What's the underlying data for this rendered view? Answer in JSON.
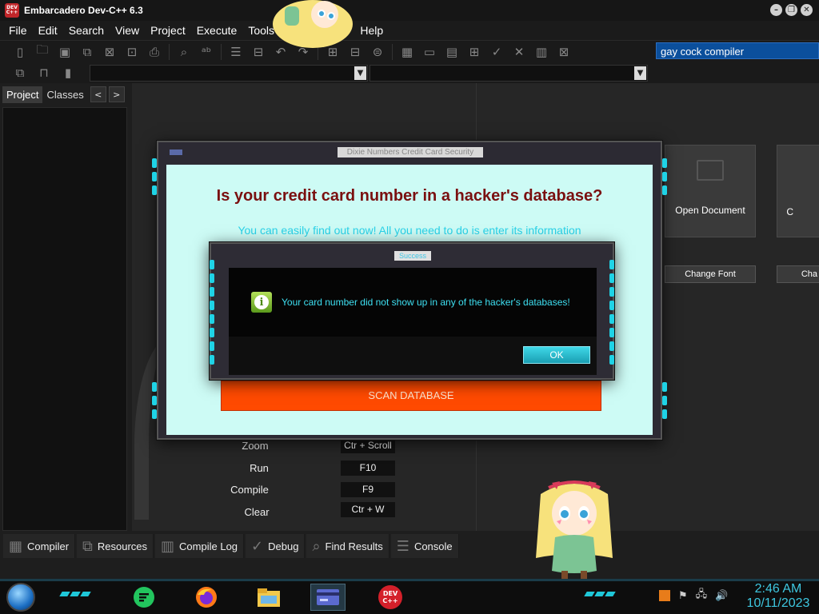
{
  "window": {
    "title": "Embarcadero Dev-C++ 6.3",
    "app_icon_text": "DEV C++",
    "controls": [
      "minimize",
      "restore",
      "close"
    ]
  },
  "menu": [
    "File",
    "Edit",
    "Search",
    "View",
    "Project",
    "Execute",
    "Tools",
    "A",
    "Help"
  ],
  "search": {
    "value": "gay cock compiler"
  },
  "left_panel": {
    "tabs": [
      "Project",
      "Classes"
    ],
    "active_tab": "Project",
    "nav": {
      "prev": "<",
      "next": ">"
    }
  },
  "welcome": {
    "tiles": [
      {
        "label": "Open Document",
        "icon": "folder-icon"
      },
      {
        "label": "C",
        "icon": "folder-icon"
      }
    ],
    "buttons": [
      "Change Font",
      "Cha"
    ],
    "shortcuts": [
      {
        "label": "Zoom",
        "key": "Ctr + Scroll"
      },
      {
        "label": "Run",
        "key": "F10"
      },
      {
        "label": "Compile",
        "key": "F9"
      },
      {
        "label": "Clear",
        "key": "Ctr + W"
      }
    ]
  },
  "bottom_tabs": [
    {
      "label": "Compiler",
      "icon": "grid-icon"
    },
    {
      "label": "Resources",
      "icon": "copy-icon"
    },
    {
      "label": "Compile Log",
      "icon": "chart-icon"
    },
    {
      "label": "Debug",
      "icon": "check-icon"
    },
    {
      "label": "Find Results",
      "icon": "search-doc-icon"
    },
    {
      "label": "Console",
      "icon": "console-icon"
    }
  ],
  "security_dialog": {
    "title": "Dixie Numbers Credit Card Security",
    "heading": "Is your credit card number in a hacker's database?",
    "subheading": "You can easily find out now! All you need to do is enter its information",
    "scan_button": "SCAN DATABASE"
  },
  "success_dialog": {
    "title": "Success",
    "message": "Your card number did not show up in any of the hacker's databases!",
    "ok_button": "OK",
    "icon": "info-icon"
  },
  "taskbar": {
    "apps": [
      "notes-app",
      "firefox",
      "file-explorer",
      "card-security-app",
      "dev-cpp"
    ],
    "active_app": "card-security-app",
    "dev_icon_text": "DEV C++",
    "clock": {
      "time": "2:46 AM",
      "date": "10/11/2023"
    }
  },
  "colors": {
    "accent_cyan": "#1fd3e6",
    "dialog_bg": "#cdfbf5",
    "heading_red": "#7a1010",
    "scan_orange": "#ff4a00",
    "search_blue": "#0b4f9c"
  }
}
